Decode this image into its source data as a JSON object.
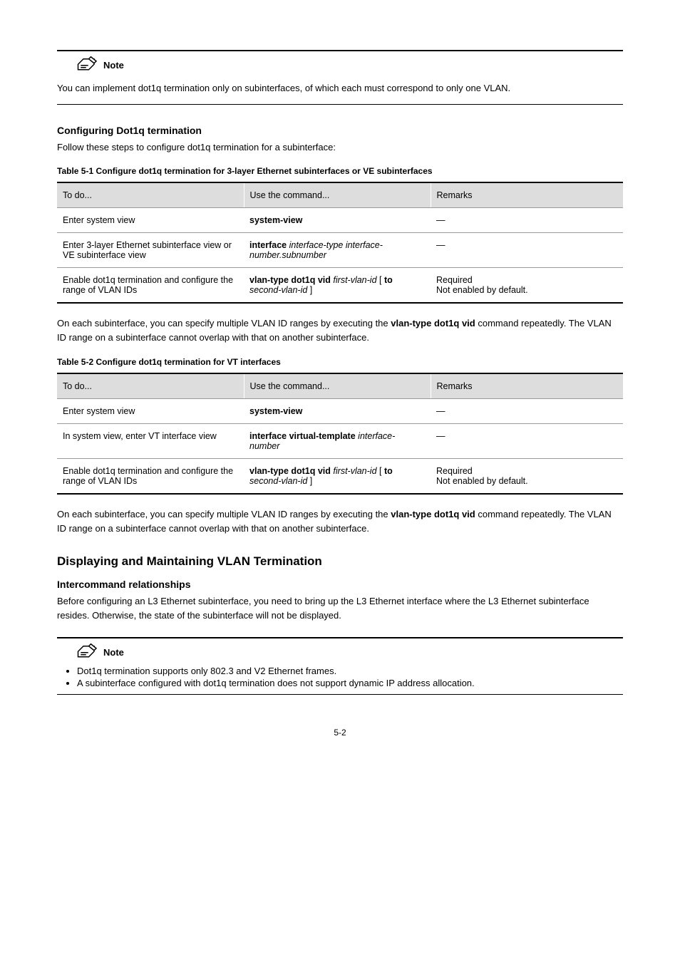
{
  "noteLabel": "Note",
  "note1": "You can implement dot1q termination only on subinterfaces, of which each must correspond to only one VLAN.",
  "section_config_title": "Configuring Dot1q termination",
  "section_config_intro": "Follow these steps to configure dot1q termination for a subinterface:",
  "table1_caption": "Table 5-1 Configure dot1q termination for 3-layer Ethernet subinterfaces or VE subinterfaces",
  "table2_caption": "Table 5-2 Configure dot1q termination for VT interfaces",
  "table_headers": [
    "To do...",
    "Use the command...",
    "Remarks"
  ],
  "table1": [
    {
      "c1": "Enter system view",
      "c2": "<b>system-view</b>",
      "c3": "—"
    },
    {
      "c1": "Enter 3-layer Ethernet subinterface view or VE subinterface view",
      "c2": "<b>interface</b> <i>interface-type interface-number.subnumber</i>",
      "c3": "—"
    },
    {
      "c1": "Enable dot1q termination and configure the range of VLAN IDs",
      "c2": "<b>vlan-type dot1q vid</b> <i>first-vlan-id</i> [ <b>to</b> <i>second-vlan-id</i> ]",
      "c3": "Required<br/>Not enabled by default."
    }
  ],
  "table2": [
    {
      "c1": "Enter system view",
      "c2": "<b>system-view</b>",
      "c3": "—"
    },
    {
      "c1": "In system view, enter VT interface view",
      "c2": "<b>interface virtual-template</b> <i>interface-number</i>",
      "c3": "—"
    },
    {
      "c1": "Enable dot1q termination and configure the range of VLAN IDs",
      "c2": "<b>vlan-type dot1q vid</b> <i>first-vlan-id</i> [ <b>to</b> <i>second-vlan-id</i> ]",
      "c3": "Required<br/>Not enabled by default."
    }
  ],
  "explain_para": "On each subinterface, you can specify multiple VLAN ID ranges by executing the vlan-type dot1q vid command repeatedly. The VLAN ID range on a subinterface cannot overlap with that on another subinterface.",
  "section_display_title": "Displaying and Maintaining VLAN Termination",
  "intercommand_title": "Intercommand relationships",
  "intercommand_para": "Before configuring an L3 Ethernet subinterface, you need to bring up the L3 Ethernet interface where the L3 Ethernet subinterface resides. Otherwise, the state of the subinterface will not be displayed.",
  "note2_items": [
    "Dot1q termination supports only 802.3 and V2 Ethernet frames.",
    "A subinterface configured with dot1q termination does not support dynamic IP address allocation."
  ],
  "page_number": "5-2"
}
